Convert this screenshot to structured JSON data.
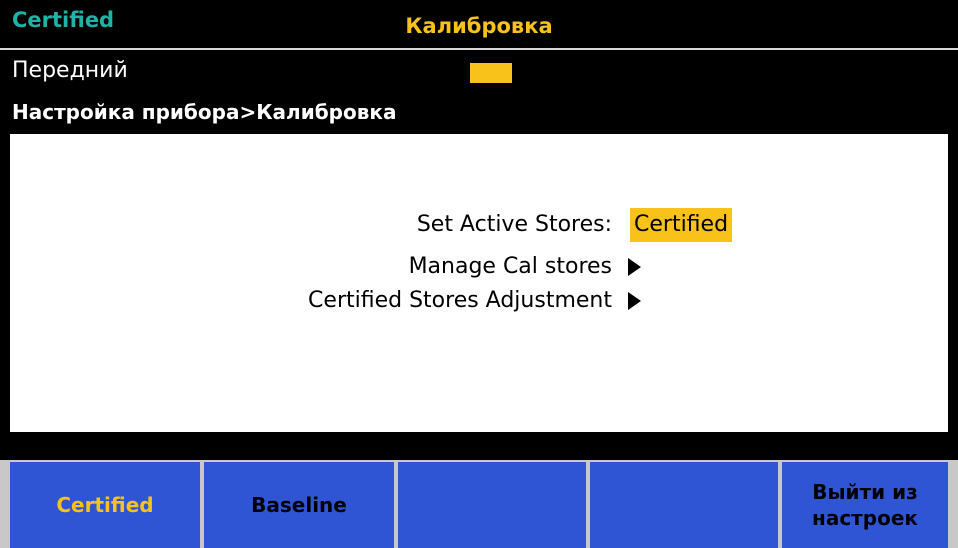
{
  "header": {
    "mode": "Certified",
    "title": "Калибровка"
  },
  "status": {
    "terminal": "Передний",
    "breadcrumb": "Настройка прибора>Калибровка"
  },
  "menu": {
    "set_active_label": "Set Active Stores:",
    "set_active_value": "Certified",
    "manage_label": "Manage Cal stores",
    "adjust_label": "Certified Stores Adjustment"
  },
  "softkeys": {
    "key1": "Certified",
    "key2": "Baseline",
    "key3": "",
    "key4": "",
    "key5": "Выйти из настроек"
  },
  "colors": {
    "accent": "#f8c21a",
    "mode": "#1fb3a8",
    "softkey": "#2f55d4"
  }
}
